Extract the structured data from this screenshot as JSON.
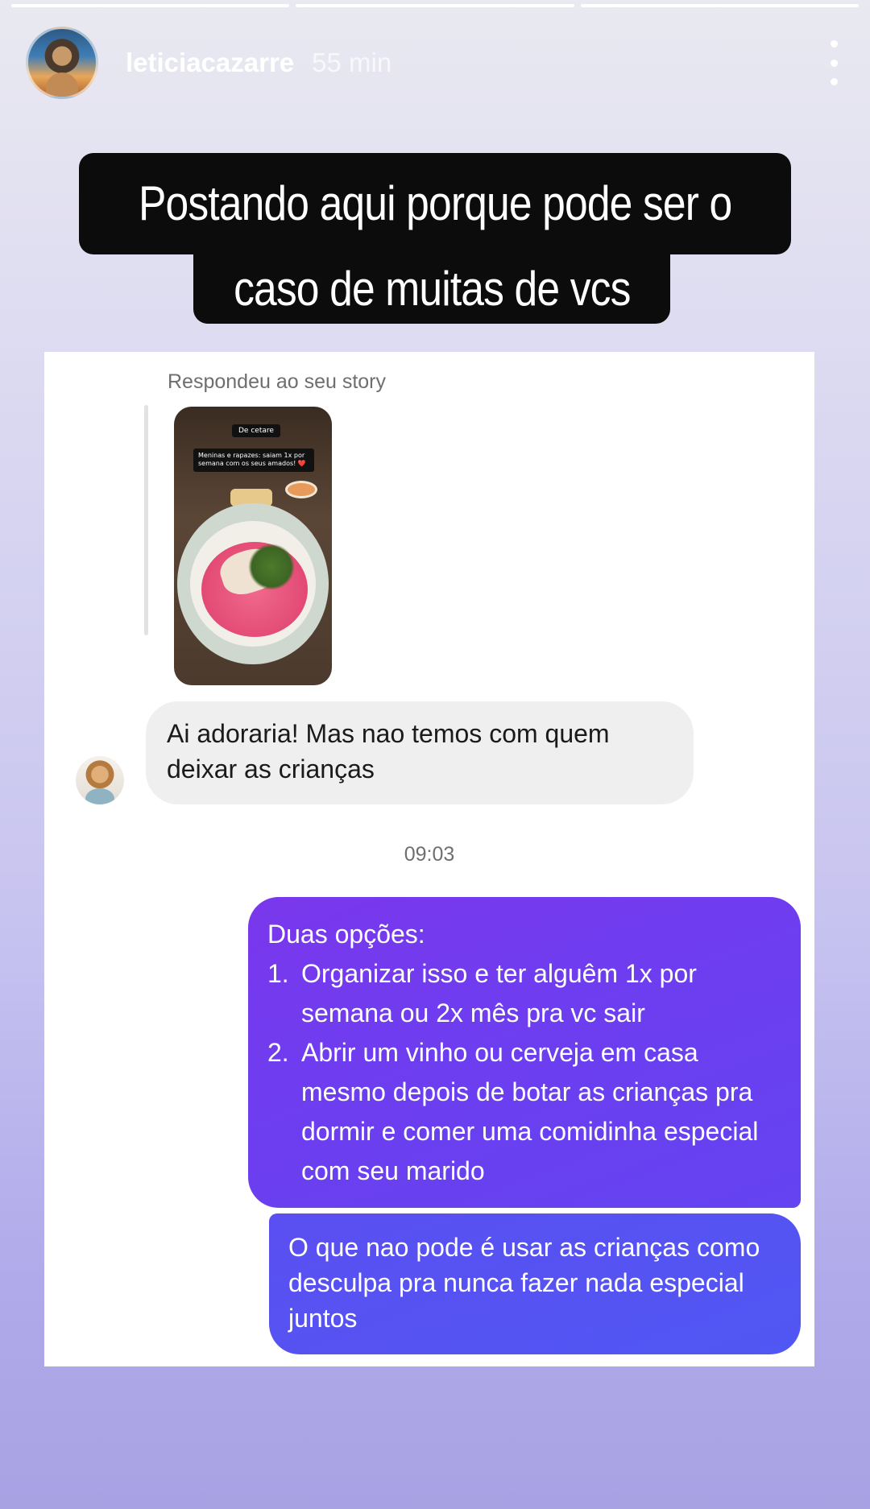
{
  "story": {
    "progress": [
      {
        "fill_percent": 100
      },
      {
        "fill_percent": 100
      },
      {
        "fill_percent": 100
      }
    ],
    "username": "leticiacazarre",
    "time_ago": "55 min",
    "caption_line1": "Postando aqui porque pode ser o",
    "caption_line2": "caso de muitas de vcs"
  },
  "dm": {
    "reply_note": "Respondeu ao seu story",
    "story_thumb": {
      "tag": "De cetare",
      "text": "Meninas e rapazes: saiam 1x por semana com os seus amados! ❤️"
    },
    "received_message": "Ai adoraria! Mas nao temos com quem deixar as crianças",
    "timestamp": "09:03",
    "sent_message_1": {
      "intro": "Duas opções:",
      "items": [
        {
          "num": "1.",
          "text": "Organizar isso e ter alguêm 1x por semana ou 2x mês pra vc sair"
        },
        {
          "num": "2.",
          "text": "Abrir um vinho ou cerveja em casa mesmo depois de botar as crianças pra dormir e comer uma comidinha especial com seu marido"
        }
      ]
    },
    "sent_message_2": "O que nao pode é usar as crianças como desculpa pra nunca fazer nada especial juntos"
  },
  "icons": {
    "more": "more-vertical-icon"
  }
}
